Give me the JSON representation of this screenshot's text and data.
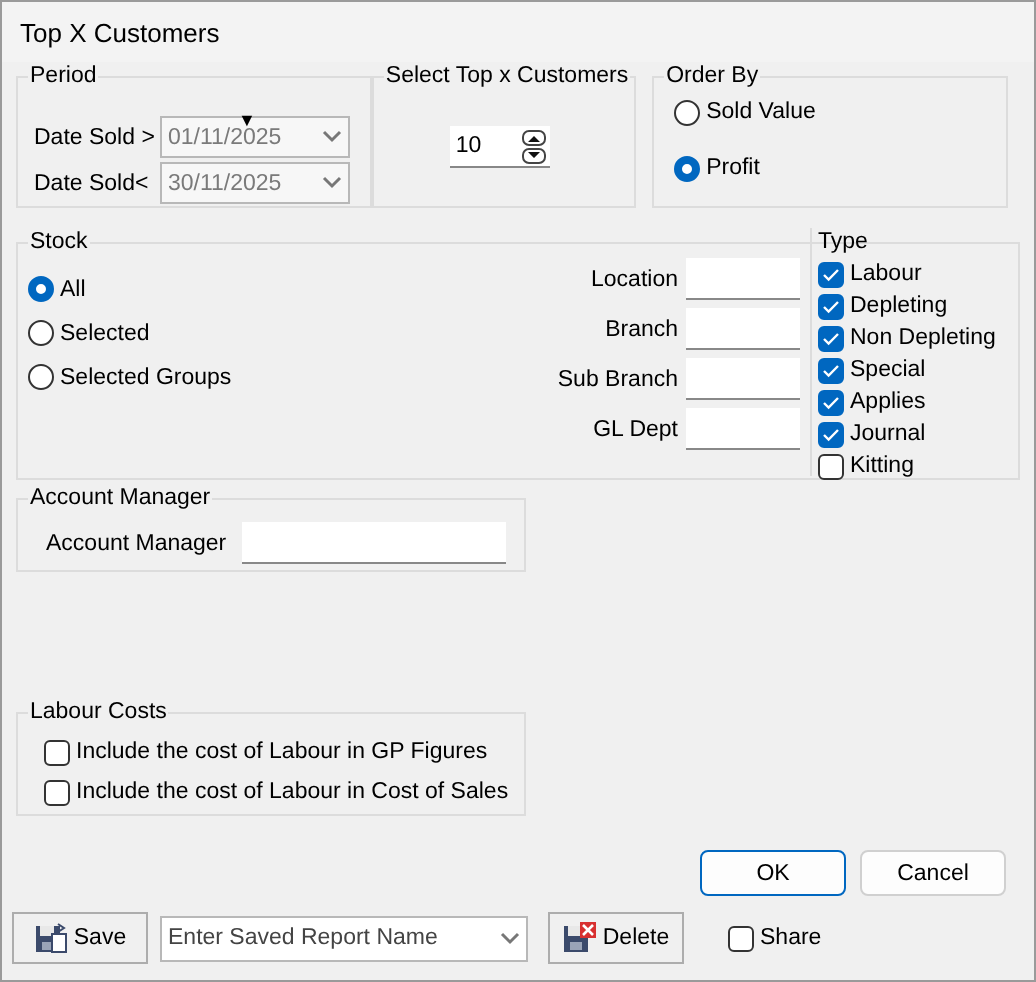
{
  "window": {
    "title": "Top X Customers"
  },
  "period": {
    "label": "Period",
    "marker": "▼",
    "rows": [
      {
        "label": "Date Sold >",
        "value": "01/11/2025",
        "disabled": true
      },
      {
        "label": "Date Sold<",
        "value": "30/11/2025",
        "disabled": true
      }
    ]
  },
  "top_x": {
    "label": "Select Top x Customers",
    "value": "10"
  },
  "order_by": {
    "label": "Order By",
    "options": [
      {
        "label": "Sold Value",
        "selected": false
      },
      {
        "label": "Profit",
        "selected": true
      }
    ]
  },
  "stock": {
    "label": "Stock",
    "options": [
      {
        "label": "All",
        "selected": true
      },
      {
        "label": "Selected",
        "selected": false
      },
      {
        "label": "Selected Groups",
        "selected": false
      }
    ],
    "fields": [
      {
        "label": "Location"
      },
      {
        "label": "Branch"
      },
      {
        "label": "Sub Branch"
      },
      {
        "label": "GL Dept"
      }
    ],
    "type": {
      "label": "Type",
      "items": [
        {
          "label": "Labour",
          "checked": true
        },
        {
          "label": "Depleting",
          "checked": true
        },
        {
          "label": "Non Depleting",
          "checked": true
        },
        {
          "label": "Special",
          "checked": true
        },
        {
          "label": "Applies",
          "checked": true
        },
        {
          "label": "Journal",
          "checked": true
        },
        {
          "label": "Kitting",
          "checked": false
        }
      ]
    }
  },
  "account_manager": {
    "label": "Account Manager",
    "field_label": "Account Manager"
  },
  "labour_costs": {
    "label": "Labour Costs",
    "options": [
      {
        "label": "Include the cost of Labour in GP Figures",
        "checked": false
      },
      {
        "label": "Include the cost of Labour in Cost of Sales",
        "checked": false
      }
    ]
  },
  "buttons": [
    {
      "label": "OK",
      "default": true
    },
    {
      "label": "Cancel",
      "default": false
    }
  ],
  "footer": {
    "save": "Save",
    "report_name": {
      "placeholder": "Enter Saved Report Name"
    },
    "delete": "Delete",
    "share": {
      "label": "Share",
      "checked": false
    }
  }
}
